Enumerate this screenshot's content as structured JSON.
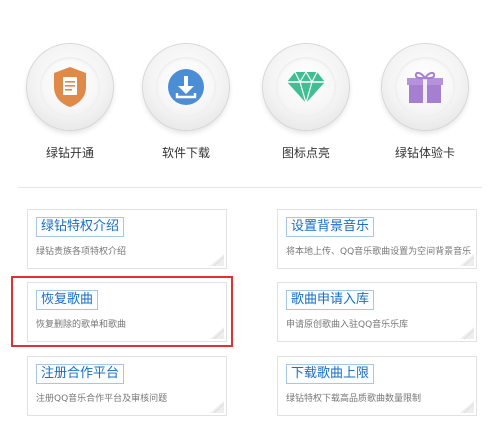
{
  "features": [
    {
      "label": "绿钻开通",
      "icon": "shield-doc-icon"
    },
    {
      "label": "软件下载",
      "icon": "download-icon"
    },
    {
      "label": "图标点亮",
      "icon": "diamond-icon"
    },
    {
      "label": "绿钻体验卡",
      "icon": "gift-icon"
    }
  ],
  "cards": [
    {
      "title": "绿钻特权介绍",
      "desc": "绿钻贵族各项特权介绍"
    },
    {
      "title": "设置背景音乐",
      "desc": "将本地上传、QQ音乐歌曲设置为空间背景音乐"
    },
    {
      "title": "恢复歌曲",
      "desc": "恢复删除的歌单和歌曲"
    },
    {
      "title": "歌曲申请入库",
      "desc": "申请原创歌曲入驻QQ音乐乐库"
    },
    {
      "title": "注册合作平台",
      "desc": "注册QQ音乐合作平台及审核问题"
    },
    {
      "title": "下载歌曲上限",
      "desc": "绿钻特权下载高品质歌曲数量限制"
    }
  ],
  "colors": {
    "accent": "#1b6ec0",
    "highlight": "#e03030",
    "shield": "#e08a4a",
    "download": "#4b8ed6",
    "diamond": "#3fbf93",
    "gift": "#a67fd0"
  }
}
